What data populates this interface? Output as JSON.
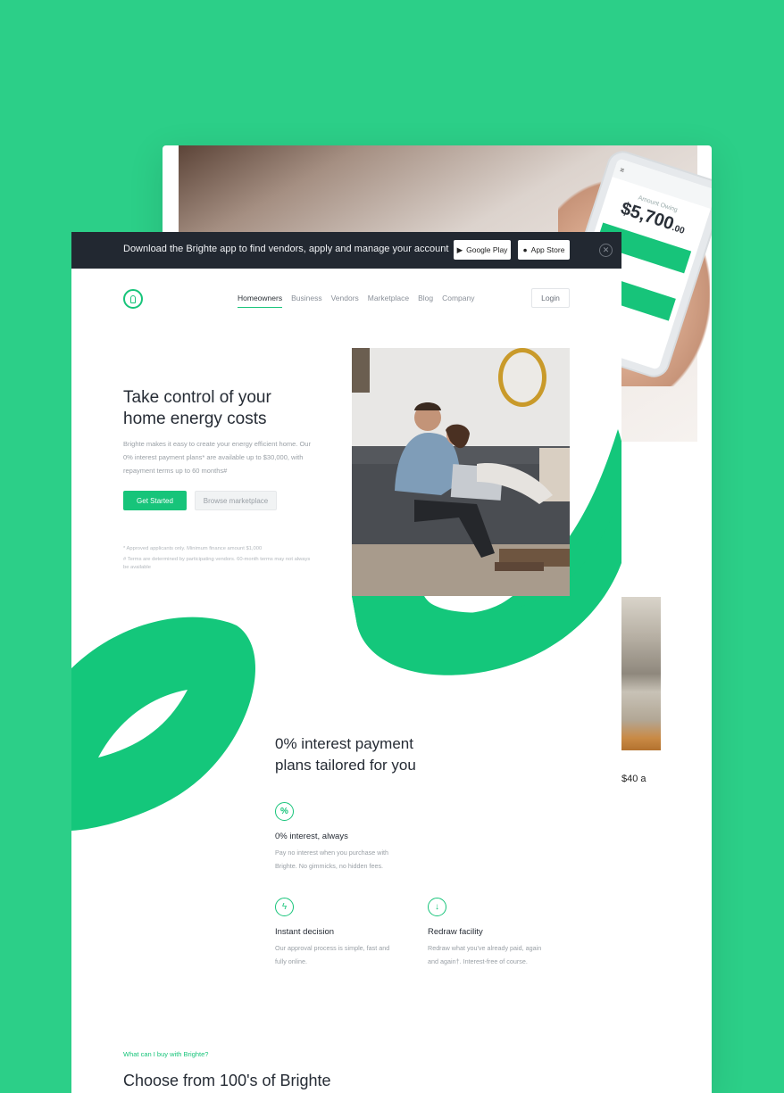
{
  "banner": {
    "text": "Download the Brighte app to find vendors, apply and manage your account",
    "google_play": "Google Play",
    "app_store": "App Store",
    "close_icon": "close-icon"
  },
  "back_page": {
    "phone": {
      "label": "Amount Owing",
      "amount": "$5,700",
      "cents": ".00"
    },
    "partial_text": "$40 a"
  },
  "nav": {
    "logo": "brighte-logo",
    "items": [
      "Homeowners",
      "Business",
      "Vendors",
      "Marketplace",
      "Blog",
      "Company"
    ],
    "active": "Homeowners",
    "login": "Login"
  },
  "hero": {
    "title": "Take control of your home energy costs",
    "description": "Brighte makes it easy to create your energy efficient home. Our 0% interest payment plans* are available up to $30,000, with repayment terms up to 60 months#",
    "primary_button": "Get Started",
    "secondary_button": "Browse marketplace",
    "footnote_1": "* Approved applicants only. Minimum finance amount $1,000",
    "footnote_2": "# Terms are determined by participating vendors. 60-month terms may not always be available"
  },
  "features": {
    "title": "0% interest payment plans tailored for you",
    "items": [
      {
        "icon": "percent-icon",
        "title": "0% interest, always",
        "desc": "Pay no interest when you purchase with Brighte. No gimmicks, no hidden fees."
      },
      {
        "icon": "lightning-icon",
        "title": "Instant decision",
        "desc": "Our approval process is simple, fast and fully online."
      },
      {
        "icon": "download-icon",
        "title": "Redraw facility",
        "desc": "Redraw what you've already paid, again and again†. Interest-free of course."
      }
    ]
  },
  "marketplace": {
    "label": "What can I buy with Brighte?",
    "title": "Choose from 100's of Brighte"
  },
  "colors": {
    "background": "#2ccf88",
    "accent": "#17c47a",
    "banner": "#222831",
    "text": "#262c35"
  }
}
